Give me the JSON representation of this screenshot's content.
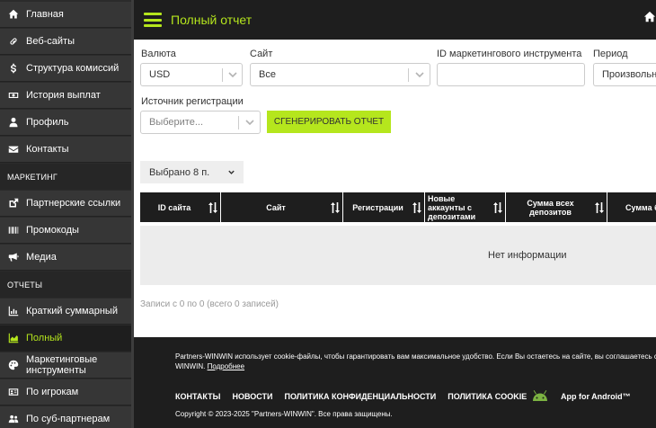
{
  "sidebar": {
    "items": [
      {
        "label": "Главная",
        "icon": "home-icon"
      },
      {
        "label": "Веб-сайты",
        "icon": "link-icon"
      },
      {
        "label": "Структура комиссий",
        "icon": "dollar-icon"
      },
      {
        "label": "История выплат",
        "icon": "money-bill-icon"
      },
      {
        "label": "Профиль",
        "icon": "user-icon"
      },
      {
        "label": "Контакты",
        "icon": "envelope-icon"
      }
    ],
    "section_marketing": "МАРКЕТИНГ",
    "marketing_items": [
      {
        "label": "Партнерские ссылки",
        "icon": "external-link-icon"
      },
      {
        "label": "Промокоды",
        "icon": "barcode-icon"
      },
      {
        "label": "Медиа",
        "icon": "bullhorn-icon"
      }
    ],
    "section_reports": "ОТЧЕТЫ",
    "report_items": [
      {
        "label": "Краткий суммарный",
        "icon": "chart-bar-icon"
      },
      {
        "label": "Полный",
        "icon": "chart-area-icon",
        "active": true
      },
      {
        "label": "Маркетинговые инструменты",
        "icon": "palette-icon"
      },
      {
        "label": "По игрокам",
        "icon": "id-card-icon"
      },
      {
        "label": "По суб-партнерам",
        "icon": "users-icon"
      }
    ]
  },
  "header": {
    "title": "Полный отчет",
    "menu_icon": "hamburger-icon",
    "home_icon": "home-icon"
  },
  "filters": {
    "currency_label": "Валюта",
    "currency_value": "USD",
    "site_label": "Сайт",
    "site_value": "Все",
    "marketing_tool_label": "ID маркетингового инструмента",
    "marketing_tool_value": "",
    "period_label": "Период",
    "period_value": "Произвольный",
    "reg_source_label": "Источник регистрации",
    "reg_source_placeholder": "Выберите...",
    "generate_button": "СГЕНЕРИРОВАТЬ ОТЧЕТ"
  },
  "table": {
    "columns_button": "Выбрано 8 п.",
    "headers": [
      "ID сайта",
      "Сайт",
      "Регистрации",
      "Новые аккаунты с депозитами",
      "Сумма всех депозитов",
      "Сумма б"
    ],
    "empty_text": "Нет информации",
    "records_info": "Записи с 0 по 0 (всего 0 записей)"
  },
  "footer": {
    "cookie_text": "Partners-WINWIN использует cookie-файлы, чтобы гарантировать вам максимальное удобство. Если Вы остаетесь на сайте, вы соглашаетесь с условиями использования cookie-файлов",
    "cookie_tail": "WINWIN.",
    "cookie_link": "Подробнее",
    "links": [
      "КОНТАКТЫ",
      "НОВОСТИ",
      "ПОЛИТИКА КОНФИДЕНЦИАЛЬНОСТИ",
      "ПОЛИТИКА COOKIE"
    ],
    "app_android": "App for Android™",
    "copyright": "Copyright © 2023-2025 \"Partners-WINWIN\". Все права защищены."
  },
  "colors": {
    "accent": "#b5e61d",
    "sidebar_bg": "#363636",
    "header_bg": "#1e1e1e",
    "android_green": "#7cb342"
  }
}
